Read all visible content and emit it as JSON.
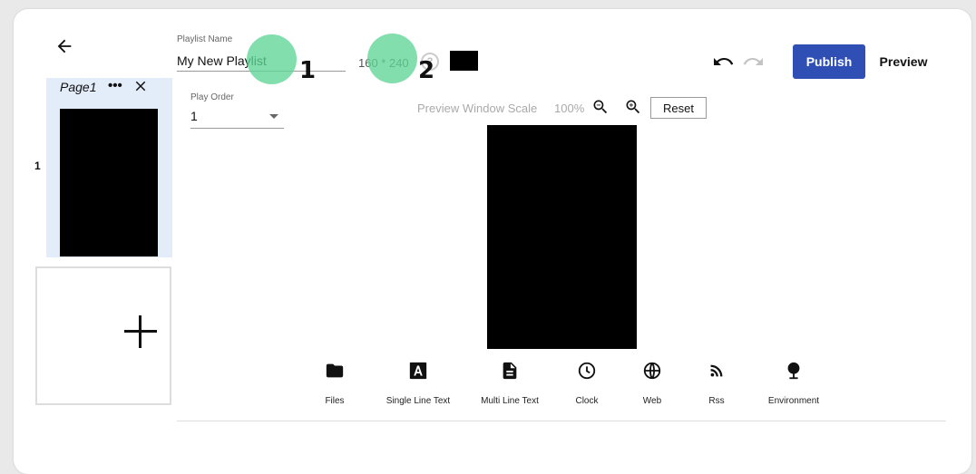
{
  "nav": {
    "back_icon": "arrow-left-icon"
  },
  "pages": {
    "items": [
      {
        "title": "Page1",
        "number": "1"
      }
    ],
    "more_icon": "more-dots-icon",
    "close_icon": "close-icon",
    "add_icon": "plus-icon"
  },
  "playlist": {
    "name_label": "Playlist Name",
    "name_value": "My New Playlist",
    "resolution": "160 * 240",
    "help_icon": "help-circle-icon",
    "background_color": "#000000"
  },
  "markers": [
    {
      "label": "1"
    },
    {
      "label": "2"
    }
  ],
  "toolbar": {
    "undo_icon": "undo-icon",
    "redo_icon": "redo-icon",
    "publish_label": "Publish",
    "preview_label": "Preview",
    "accent_color": "#2f4fb5"
  },
  "play_order": {
    "label": "Play Order",
    "value": "1"
  },
  "scale": {
    "label": "Preview Window Scale",
    "value": "100%",
    "zoom_out_icon": "zoom-out-icon",
    "zoom_in_icon": "zoom-in-icon",
    "reset_label": "Reset"
  },
  "widgets": [
    {
      "label": "Files",
      "icon": "folder-icon"
    },
    {
      "label": "Single Line Text",
      "icon": "text-a-icon"
    },
    {
      "label": "Multi Line Text",
      "icon": "document-icon"
    },
    {
      "label": "Clock",
      "icon": "clock-icon"
    },
    {
      "label": "Web",
      "icon": "globe-icon"
    },
    {
      "label": "Rss",
      "icon": "rss-icon"
    },
    {
      "label": "Environment",
      "icon": "tree-icon"
    }
  ]
}
